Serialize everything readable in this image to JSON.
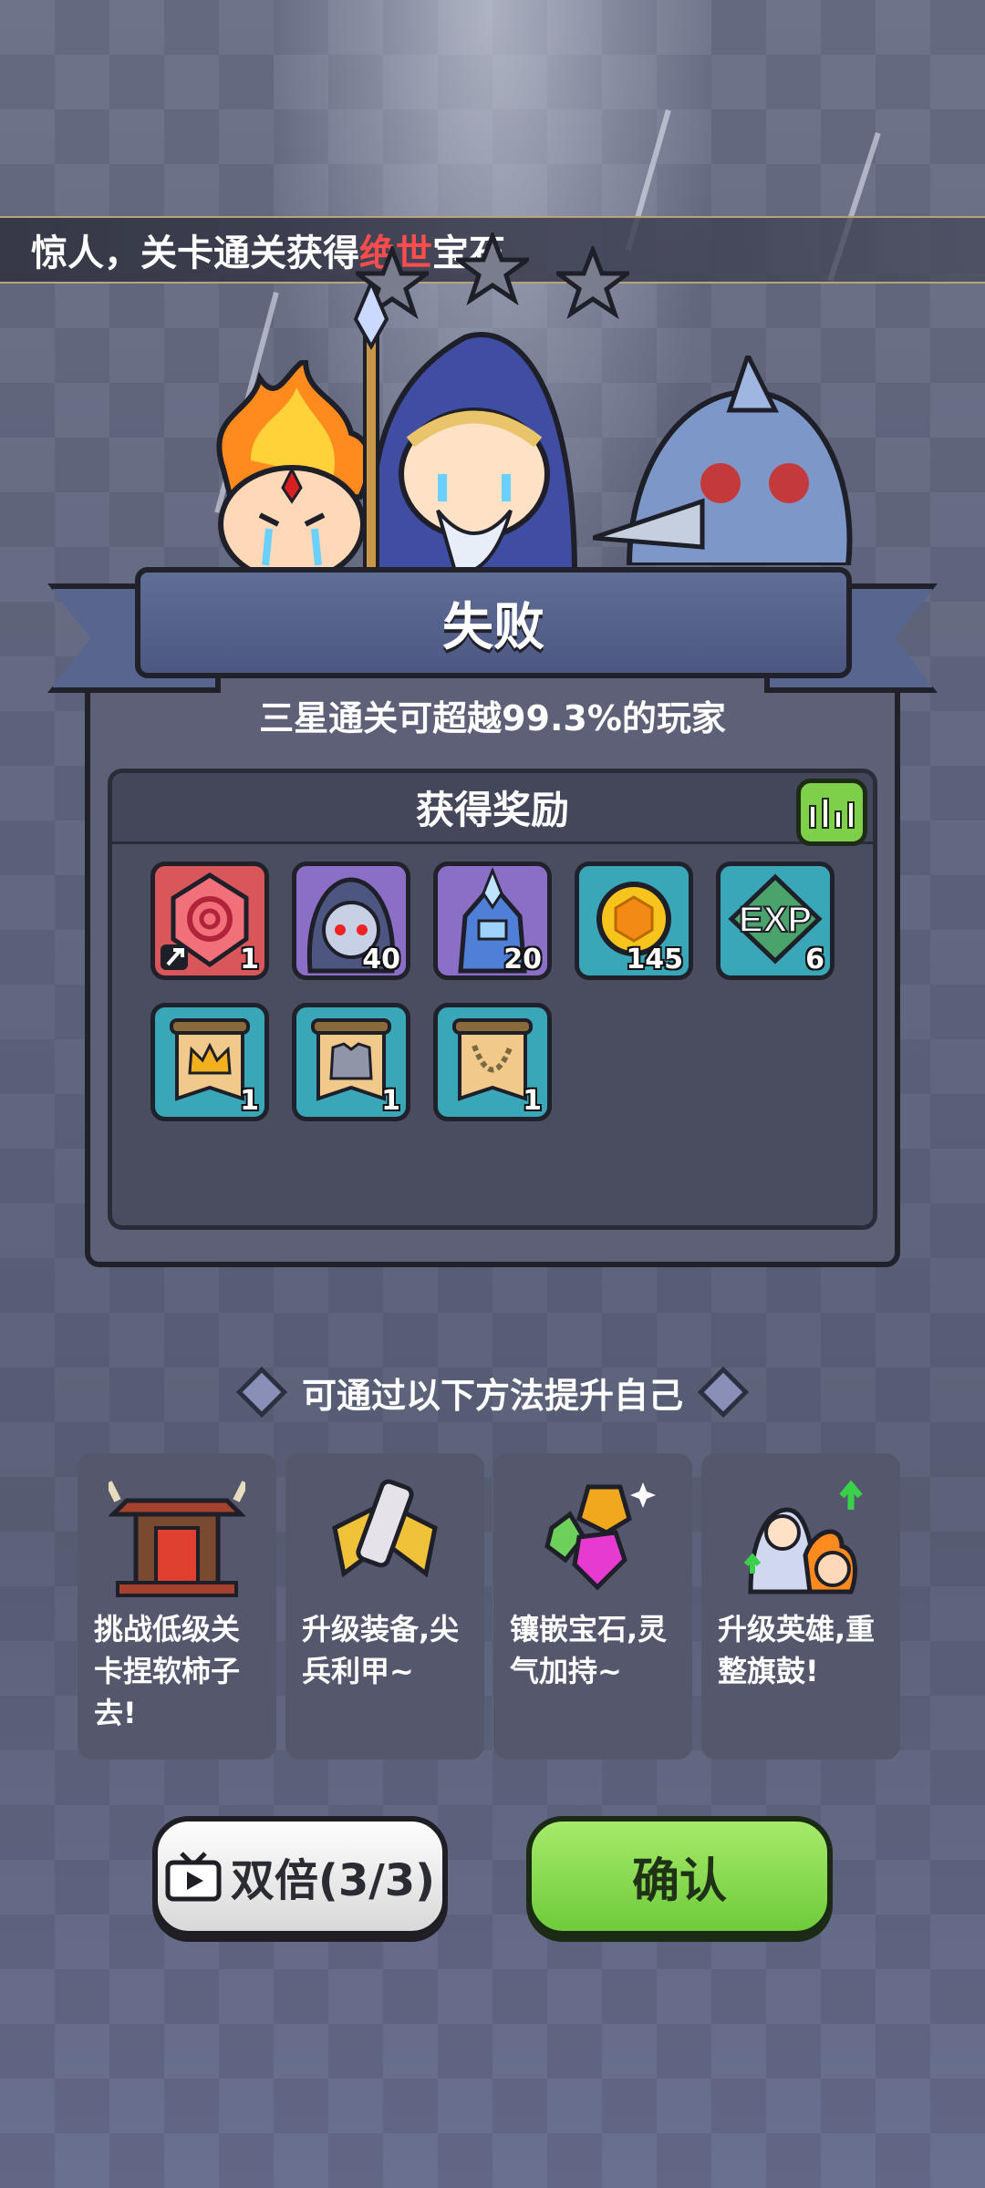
{
  "ticker": {
    "prefix": "惊人，关卡通关获得",
    "highlight": "绝世",
    "suffix": "宝石"
  },
  "result": {
    "title": "失败",
    "subtitle": "三星通关可超越99.3%的玩家"
  },
  "rewards": {
    "heading": "获得奖励",
    "items": [
      {
        "icon": "red-gem-icon",
        "count": "1"
      },
      {
        "icon": "hooded-hero-icon",
        "count": "40"
      },
      {
        "icon": "crystal-knight-icon",
        "count": "20"
      },
      {
        "icon": "gold-coin-icon",
        "count": "145"
      },
      {
        "icon": "exp-icon",
        "count": "6"
      },
      {
        "icon": "crown-scroll-icon",
        "count": "1"
      },
      {
        "icon": "armor-scroll-icon",
        "count": "1"
      },
      {
        "icon": "necklace-scroll-icon",
        "count": "1"
      }
    ]
  },
  "improve": {
    "title": "可通过以下方法提升自己",
    "cards": [
      {
        "icon": "gate-icon",
        "text": "挑战低级关卡捏软柿子去!"
      },
      {
        "icon": "equipment-icon",
        "text": "升级装备,尖兵利甲~"
      },
      {
        "icon": "gems-icon",
        "text": "镶嵌宝石,灵气加持~"
      },
      {
        "icon": "heroes-upgrade-icon",
        "text": "升级英雄,重整旗鼓!"
      }
    ]
  },
  "buttons": {
    "double": "双倍(3/3)",
    "confirm": "确认"
  },
  "colors": {
    "accent_red": "#ff4d4d",
    "confirm_green": "#7ed04a",
    "banner_blue": "#58658e"
  }
}
